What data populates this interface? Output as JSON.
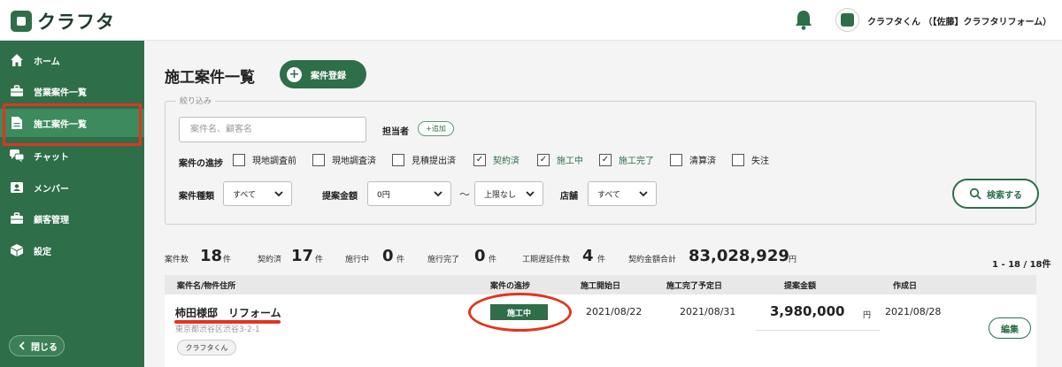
{
  "app": {
    "logo_text": "クラフタ",
    "user_name": "クラフタくん （【佐藤】クラフタリフォーム）"
  },
  "sidebar": {
    "items": [
      {
        "label": "ホーム",
        "icon": "home-icon"
      },
      {
        "label": "営業案件一覧",
        "icon": "briefcase-icon"
      },
      {
        "label": "施工案件一覧",
        "icon": "document-icon"
      },
      {
        "label": "チャット",
        "icon": "chat-icon"
      },
      {
        "label": "メンバー",
        "icon": "member-icon"
      },
      {
        "label": "顧客管理",
        "icon": "customer-icon"
      },
      {
        "label": "設定",
        "icon": "cube-icon"
      }
    ],
    "close_label": "閉じる"
  },
  "page": {
    "title": "施工案件一覧",
    "register_label": "案件登録"
  },
  "filter": {
    "legend": "絞り込み",
    "search_placeholder": "案件名、顧客名",
    "assignee_label": "担当者",
    "add_label": "+追加",
    "progress_label": "案件の進捗",
    "progress_options": [
      {
        "label": "現地調査前",
        "checked": false
      },
      {
        "label": "現地調査済",
        "checked": false
      },
      {
        "label": "見積提出済",
        "checked": false
      },
      {
        "label": "契約済",
        "checked": true
      },
      {
        "label": "施工中",
        "checked": true
      },
      {
        "label": "施工完了",
        "checked": true
      },
      {
        "label": "清算済",
        "checked": false
      },
      {
        "label": "失注",
        "checked": false
      }
    ],
    "kind_label": "案件種類",
    "kind_value": "すべて",
    "amount_label": "提案金額",
    "amount_min": "0円",
    "amount_tilde": "〜",
    "amount_max": "上限なし",
    "shop_label": "店舗",
    "shop_value": "すべて",
    "search_label": "検索する"
  },
  "stats": {
    "cases_label": "案件数",
    "cases_value": "18",
    "cases_unit": "件",
    "contract_label": "契約済",
    "contract_value": "17",
    "contract_unit": "件",
    "ongoing_label": "施行中",
    "ongoing_value": "0",
    "ongoing_unit": "件",
    "done_label": "施行完了",
    "done_value": "0",
    "done_unit": "件",
    "delay_label": "工期遅延件数",
    "delay_value": "4",
    "delay_unit": "件",
    "total_label": "契約金額合計",
    "total_value": "83,028,929",
    "total_unit": "円",
    "pager": "1 - 18 / 18件"
  },
  "table": {
    "headers": {
      "name": "案件名/物件住所",
      "progress": "案件の進捗",
      "start": "施工開始日",
      "end": "施工完了予定日",
      "amount": "提案金額",
      "created": "作成日"
    },
    "rows": [
      {
        "title": "柿田様邸　リフォーム",
        "address": "東京都渋谷区渋谷3-2-1",
        "tag": "クラフタくん",
        "status": "施工中",
        "start": "2021/08/22",
        "end": "2021/08/31",
        "amount": "3,980,000",
        "amount_unit": "円",
        "created": "2021/08/28",
        "edit_label": "編集"
      }
    ]
  },
  "colors": {
    "brand": "#2e6e49",
    "highlight": "#e0351f"
  }
}
